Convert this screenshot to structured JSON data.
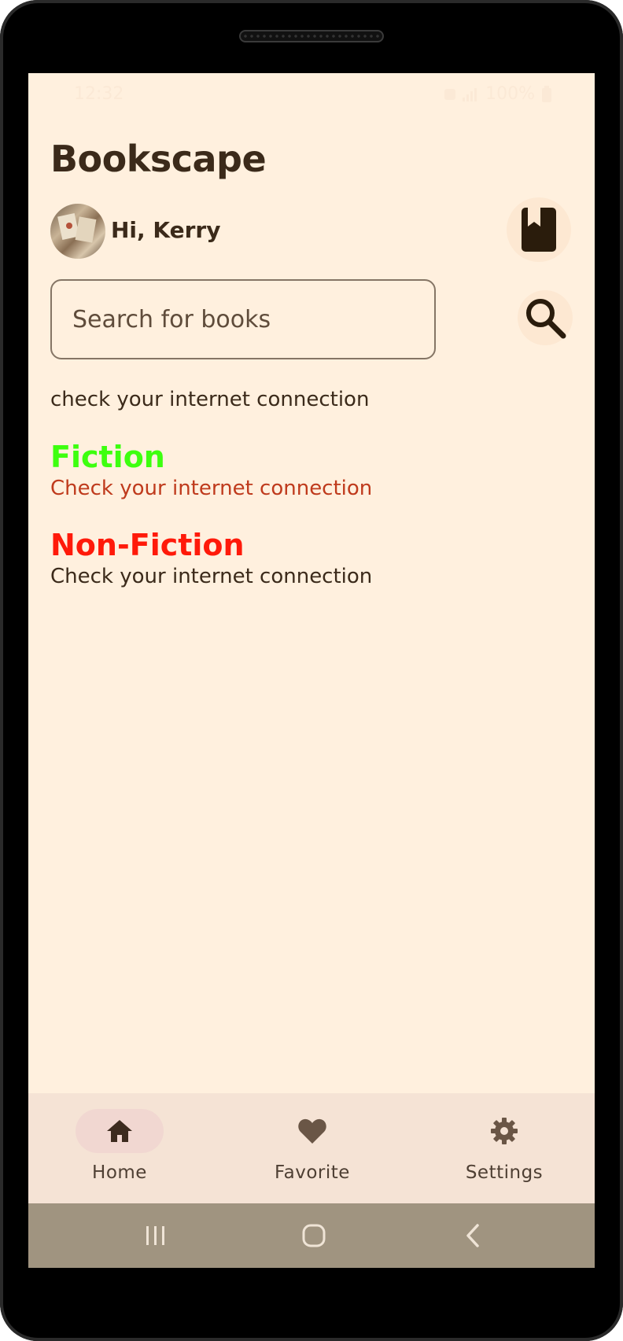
{
  "status_bar": {
    "time": "12:32",
    "battery": "100%"
  },
  "app": {
    "title": "Bookscape"
  },
  "user": {
    "greeting": "Hi, Kerry"
  },
  "search": {
    "placeholder": "Search for books",
    "value": ""
  },
  "connection_message": "check your internet connection",
  "sections": [
    {
      "title": "Fiction",
      "title_color": "#3dff0f",
      "message": "Check your internet connection",
      "message_color": "#bf3a1c"
    },
    {
      "title": "Non-Fiction",
      "title_color": "#ff1a0a",
      "message": "Check your internet connection",
      "message_color": "#3b2a1a"
    }
  ],
  "bottom_nav": {
    "items": [
      {
        "label": "Home",
        "icon": "home-icon",
        "active": true
      },
      {
        "label": "Favorite",
        "icon": "heart-icon",
        "active": false
      },
      {
        "label": "Settings",
        "icon": "gear-icon",
        "active": false
      }
    ]
  },
  "colors": {
    "background": "#fff0de",
    "text_primary": "#3b2a1a",
    "nav_background": "#f5e3d5",
    "system_bar": "#a09480"
  }
}
